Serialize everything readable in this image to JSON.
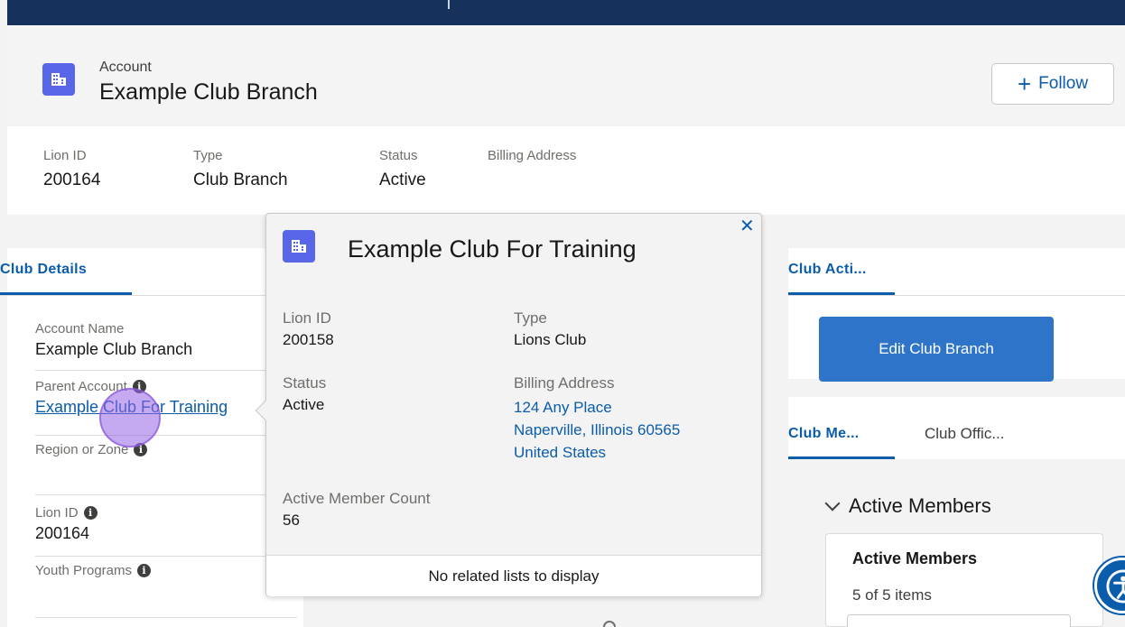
{
  "header": {
    "object_label": "Account",
    "record_name": "Example Club Branch",
    "follow_label": "Follow",
    "icon": "account-building-icon"
  },
  "highlights": [
    {
      "label": "Lion ID",
      "value": "200164"
    },
    {
      "label": "Type",
      "value": "Club Branch"
    },
    {
      "label": "Status",
      "value": "Active"
    },
    {
      "label": "Billing Address",
      "value": ""
    }
  ],
  "club_details": {
    "tab_label": "Club Details",
    "account_name_label": "Account Name",
    "account_name_value": "Example Club Branch",
    "parent_account_label": "Parent Account",
    "parent_account_value": "Example Club For Training",
    "region_label": "Region or Zone",
    "lion_id_label": "Lion ID",
    "lion_id_value": "200164",
    "youth_label": "Youth Programs"
  },
  "popover": {
    "title": "Example Club For Training",
    "close_glyph": "✕",
    "lion_id_label": "Lion ID",
    "lion_id_value": "200158",
    "type_label": "Type",
    "type_value": "Lions Club",
    "status_label": "Status",
    "status_value": "Active",
    "billing_label": "Billing Address",
    "billing_line1": "124 Any Place",
    "billing_line2": "Naperville, Illinois 60565",
    "billing_line3": "United States",
    "member_count_label": "Active Member Count",
    "member_count_value": "56",
    "footer_text": "No related lists to display"
  },
  "club_actions": {
    "tab_label": "Club Acti...",
    "edit_button": "Edit Club Branch"
  },
  "members": {
    "tab1": "Club Me...",
    "tab2": "Club Offic...",
    "section_toggle": "Active Members",
    "list_title": "Active Members",
    "count": "5 of 5 items"
  },
  "colors": {
    "brand": "#0b5cab",
    "account_icon": "#5867e8",
    "topbar": "#16325c",
    "button": "#2e74c9"
  }
}
